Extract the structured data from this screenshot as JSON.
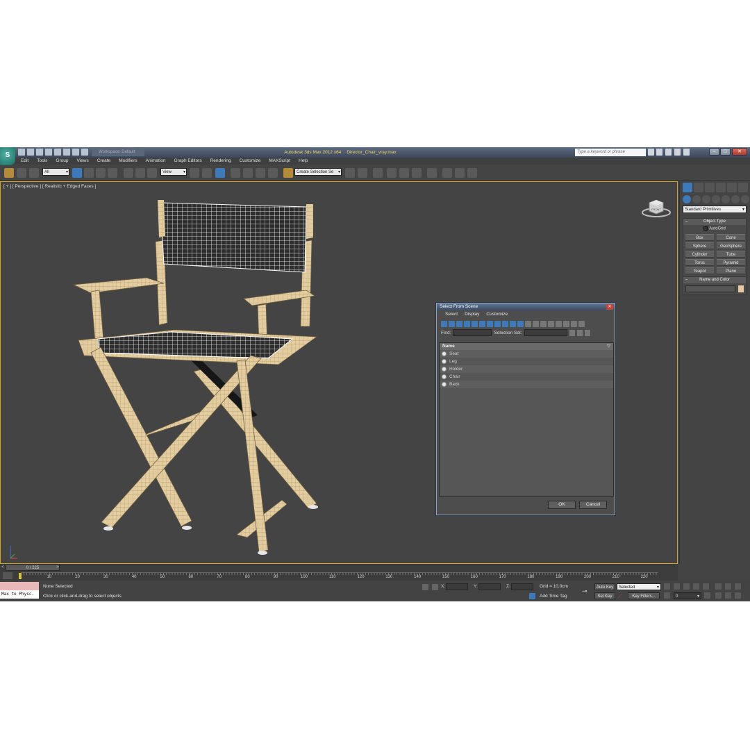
{
  "titlebar": {
    "workspace": "Workspace: Default",
    "app_title": "Autodesk 3ds Max  2012 x64",
    "file_name": "Director_Chair_vray.max",
    "search_placeholder": "Type a keyword or phrase"
  },
  "menu": [
    "Edit",
    "Tools",
    "Group",
    "Views",
    "Create",
    "Modifiers",
    "Animation",
    "Graph Editors",
    "Rendering",
    "Customize",
    "MAXScript",
    "Help"
  ],
  "toolbar": {
    "filter_value": "All",
    "refcoord_value": "View",
    "selection_set_placeholder": "Create Selection Se"
  },
  "viewport": {
    "label": "[ + ] [ Perspective ] [ Realistic + Edged Faces ]",
    "viewcube_label": "FRONT"
  },
  "command_panel": {
    "category": "Standard Primitives",
    "object_type_title": "Object Type",
    "autogrid_label": "AutoGrid",
    "object_buttons": [
      "Box",
      "Cone",
      "Sphere",
      "GeoSphere",
      "Cylinder",
      "Tube",
      "Torus",
      "Pyramid",
      "Teapot",
      "Plane"
    ],
    "name_color_title": "Name and Color",
    "name_color_swatch": "#e6c9a4"
  },
  "dialog": {
    "title": "Select From Scene",
    "menus": [
      "Select",
      "Display",
      "Customize"
    ],
    "find_label": "Find:",
    "selection_set_label": "Selection Set:",
    "list_header": "Name",
    "items": [
      "Seat",
      "Leg",
      "Holder",
      "Chair",
      "Back"
    ],
    "ok_label": "OK",
    "cancel_label": "Cancel"
  },
  "timeline": {
    "slider_text": "0 / 225",
    "ticks": [
      "10",
      "20",
      "30",
      "40",
      "50",
      "60",
      "70",
      "80",
      "90",
      "100",
      "110",
      "120",
      "130",
      "140",
      "150",
      "160",
      "170",
      "180",
      "190",
      "200",
      "210",
      "220"
    ]
  },
  "status": {
    "maxscript_text": "Max to Physc.",
    "selection_status": "None Selected",
    "prompt": "Click or click-and-drag to select objects",
    "x_label": "X:",
    "y_label": "Y:",
    "z_label": "Z:",
    "grid_text": "Grid = 10,0cm",
    "add_time_tag": "Add Time Tag",
    "auto_key": "Auto Key",
    "set_key": "Set Key",
    "key_mode_value": "Selected",
    "key_filters": "Key Filters...",
    "frame_value": "0"
  },
  "colors": {
    "viewport_border": "#d6a420",
    "wood": "#e3cc9f",
    "title_text": "#f5d26a",
    "accent": "#3e7ab8"
  }
}
